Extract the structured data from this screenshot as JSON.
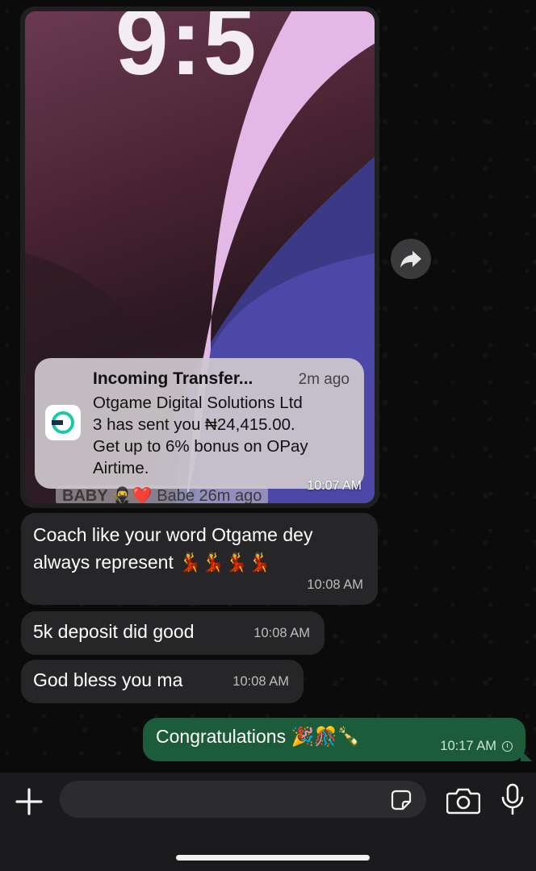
{
  "image_message": {
    "clock_text": "9:5",
    "notification": {
      "title": "Incoming Transfer...",
      "time": "2m ago",
      "lines": [
        "Otgame Digital Solutions Ltd",
        "3 has sent you ₦24,415.00.",
        "Get up to 6% bonus on OPay",
        "Airtime."
      ]
    },
    "background_row": {
      "name": "BABY",
      "emojis": "🥷❤️",
      "label": "Babe",
      "age": "26m ago"
    },
    "time": "10:07 AM"
  },
  "messages": [
    {
      "text": "Coach like your word Otgame dey always represent 💃💃💃💃",
      "time": "10:08 AM"
    },
    {
      "text": "5k deposit did good",
      "time": "10:08 AM"
    },
    {
      "text": "God bless you ma",
      "time": "10:08 AM"
    }
  ],
  "outgoing": {
    "text": "Congratulations 🎉🎊🍾",
    "time": "10:17 AM"
  },
  "colors": {
    "outgoing_bubble": "#1c5c3a",
    "incoming_bubble": "#262628",
    "opay_accent": "#1dc8a6"
  },
  "icons": [
    "forward-icon",
    "plus-icon",
    "sticker-icon",
    "camera-icon",
    "mic-icon",
    "pending-clock-icon"
  ]
}
